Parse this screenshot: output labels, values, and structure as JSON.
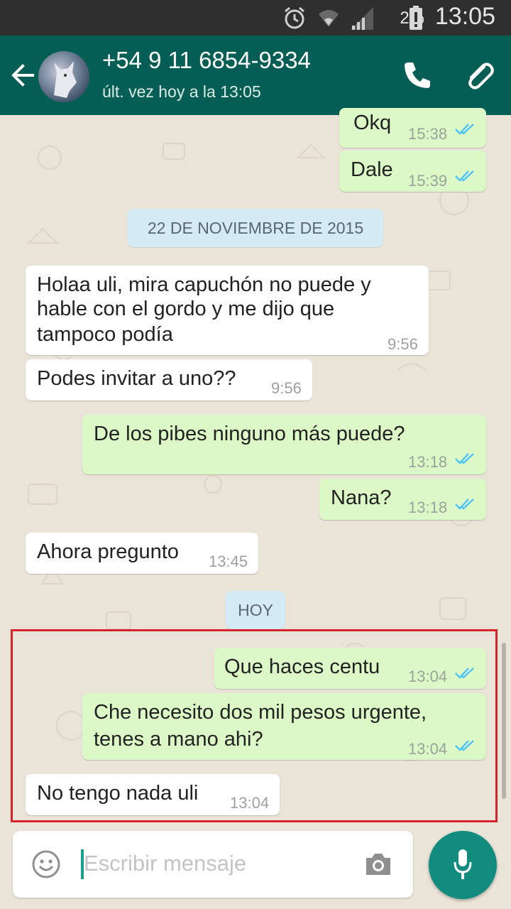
{
  "status_bar": {
    "battery_percent": "2%",
    "time": "13:05"
  },
  "header": {
    "contact_name": "+54 9 11 6854-9334",
    "last_seen": "últ. vez hoy a la 13:05",
    "back_icon": "arrow-left-icon",
    "call_icon": "phone-icon",
    "attach_icon": "paperclip-icon"
  },
  "messages": [
    {
      "direction": "out",
      "text": "Okq",
      "time": "15:38",
      "status": "read"
    },
    {
      "direction": "out",
      "text": "Dale",
      "time": "15:39",
      "status": "read"
    },
    {
      "type": "date",
      "text": "22 DE NOVIEMBRE DE 2015"
    },
    {
      "direction": "in",
      "lines": [
        "Holaa uli, mira capuchón no puede y",
        "hable con el gordo y me dijo que",
        "tampoco podía"
      ],
      "time": "9:56"
    },
    {
      "direction": "in",
      "text": "Podes invitar a uno??",
      "time": "9:56"
    },
    {
      "direction": "out",
      "text": "De los pibes ninguno más puede?",
      "time": "13:18",
      "status": "read"
    },
    {
      "direction": "out",
      "text": "Nana?",
      "time": "13:18",
      "status": "read"
    },
    {
      "direction": "in",
      "text": "Ahora pregunto",
      "time": "13:45"
    },
    {
      "type": "date",
      "text": "HOY"
    },
    {
      "direction": "out",
      "text": "Que haces centu",
      "time": "13:04",
      "status": "read"
    },
    {
      "direction": "out",
      "lines": [
        "Che necesito dos mil pesos urgente,",
        "tenes a mano ahi?"
      ],
      "time": "13:04",
      "status": "read"
    },
    {
      "direction": "in",
      "text": "No tengo nada uli",
      "time": "13:04"
    }
  ],
  "input": {
    "placeholder": "Escribir mensaje",
    "emoji_icon": "emoji-icon",
    "camera_icon": "camera-icon",
    "mic_icon": "microphone-icon"
  },
  "colors": {
    "app_bar": "#075e54",
    "outgoing_bubble": "#dcf8c6",
    "incoming_bubble": "#ffffff",
    "read_ticks": "#4fc3f7",
    "mic_button": "#128c7e",
    "highlight_border": "#d7232b"
  }
}
